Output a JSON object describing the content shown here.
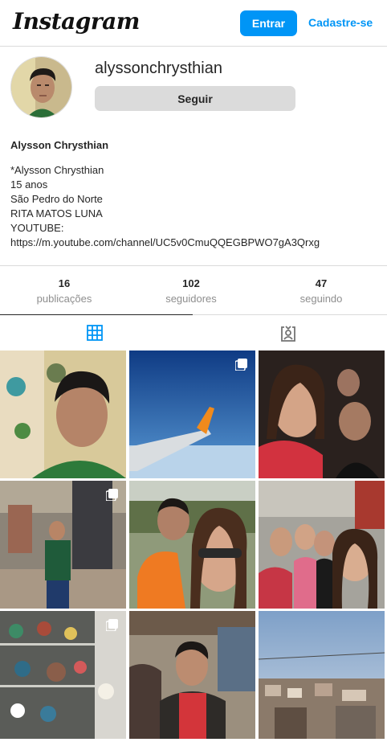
{
  "header": {
    "logo": "Instagram",
    "login_label": "Entrar",
    "signup_label": "Cadastre-se",
    "accent_color": "#0095f6"
  },
  "profile": {
    "username": "alyssonchrysthian",
    "follow_label": "Seguir",
    "full_name": "Alysson Chrysthian",
    "bio_lines": [
      "*Alysson Chrysthian",
      "15 anos",
      "São Pedro do Norte",
      "RITA MATOS LUNA",
      "YOUTUBE:",
      "https://m.youtube.com/channel/UC5v0CmuQQEGBPWO7gA3Qrxg"
    ]
  },
  "stats": {
    "posts": {
      "count": "16",
      "label": "publicações"
    },
    "followers": {
      "count": "102",
      "label": "seguidores"
    },
    "following": {
      "count": "47",
      "label": "seguindo"
    }
  },
  "tabs": [
    {
      "icon": "grid-icon",
      "active": true
    },
    {
      "icon": "tagged-icon",
      "active": false
    }
  ],
  "posts": [
    {
      "subject": "selfie of young man in green shirt",
      "multi": false
    },
    {
      "subject": "airplane wing over blue sky",
      "multi": true
    },
    {
      "subject": "group selfie at night",
      "multi": false
    },
    {
      "subject": "man standing in front of city buildings",
      "multi": true
    },
    {
      "subject": "selfie on boat on river",
      "multi": false
    },
    {
      "subject": "group of women in street",
      "multi": false
    },
    {
      "subject": "shelf with figurines",
      "multi": true
    },
    {
      "subject": "young man in red shirt in mall",
      "multi": false
    },
    {
      "subject": "city view at sunset",
      "multi": false
    }
  ]
}
